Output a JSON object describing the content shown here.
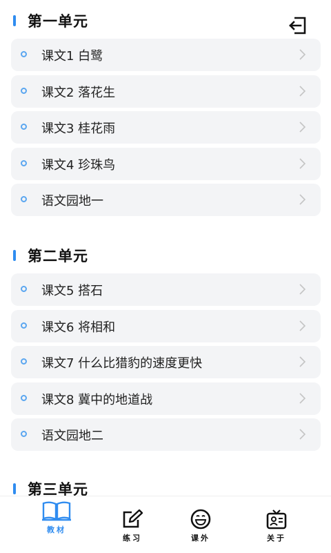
{
  "colors": {
    "accent": "#2f8cf0",
    "item_bg": "#f3f4f6",
    "dot": "#5aa6f0"
  },
  "header": {
    "exit_icon": "exit-icon"
  },
  "units": [
    {
      "title": "第一单元",
      "items": [
        "课文1 白鹭",
        "课文2 落花生",
        "课文3 桂花雨",
        "课文4 珍珠鸟",
        "语文园地一"
      ]
    },
    {
      "title": "第二单元",
      "items": [
        "课文5 搭石",
        "课文6 将相和",
        "课文7 什么比猎豹的速度更快",
        "课文8 冀中的地道战",
        "语文园地二"
      ]
    },
    {
      "title": "第三单元",
      "items": []
    }
  ],
  "tabs": [
    {
      "label": "教材",
      "icon": "book-icon",
      "active": true
    },
    {
      "label": "练习",
      "icon": "edit-icon",
      "active": false
    },
    {
      "label": "课外",
      "icon": "smile-icon",
      "active": false
    },
    {
      "label": "关于",
      "icon": "badge-icon",
      "active": false
    }
  ]
}
